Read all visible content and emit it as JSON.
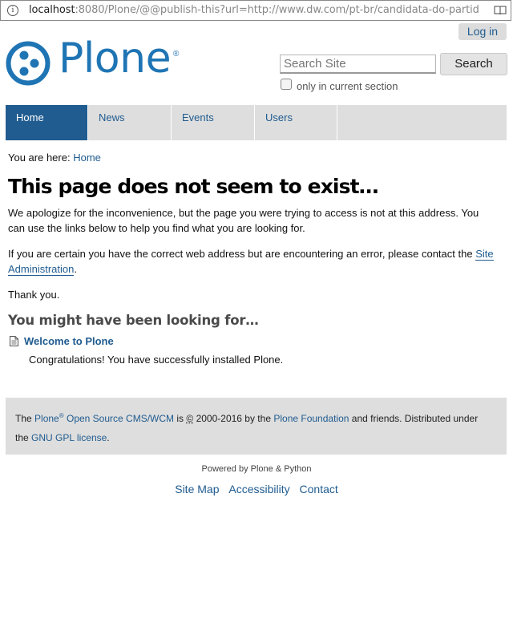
{
  "browser": {
    "url_host": "localhost",
    "url_rest": ":8080/Plone/@@publish-this?url=http://www.dw.com/pt-br/candidata-do-partid"
  },
  "header": {
    "login_label": "Log in",
    "logo_text": "Plone",
    "logo_reg": "®",
    "search_placeholder": "Search Site",
    "search_button": "Search",
    "only_current_section": "only in current section"
  },
  "nav": {
    "items": [
      {
        "label": "Home"
      },
      {
        "label": "News"
      },
      {
        "label": "Events"
      },
      {
        "label": "Users"
      }
    ]
  },
  "breadcrumb": {
    "prefix": "You are here:",
    "home": "Home"
  },
  "content": {
    "title": "This page does not seem to exist…",
    "apology_line1": "We apologize for the inconvenience, but the page you were trying to access is not at this address. You",
    "apology_line2": "can use the links below to help you find what you are looking for.",
    "certain_line1": "If you are certain you have the correct web address but are encountering an error, please contact the",
    "site_link_1": "Site",
    "site_link_2": "Administration",
    "certain_end": ".",
    "thanks": "Thank you.",
    "looking_title": "You might have been looking for…",
    "result_title": "Welcome to Plone",
    "result_desc": "Congratulations! You have successfully installed Plone."
  },
  "footer": {
    "the": "The",
    "plone": "Plone",
    "reg": "®",
    "cms": "Open Source CMS/WCM",
    "is": "is",
    "copy": "©",
    "years_by": "2000-2016 by the",
    "foundation": "Plone Foundation",
    "friends": "and friends. Distributed under",
    "the2": "the",
    "license": "GNU GPL license",
    "period": ".",
    "powered": "Powered by Plone & Python",
    "links": [
      "Site Map",
      "Accessibility",
      "Contact"
    ]
  },
  "colors": {
    "brand": "#1f75b4",
    "link": "#205c90",
    "nav_bg": "#dedede"
  }
}
